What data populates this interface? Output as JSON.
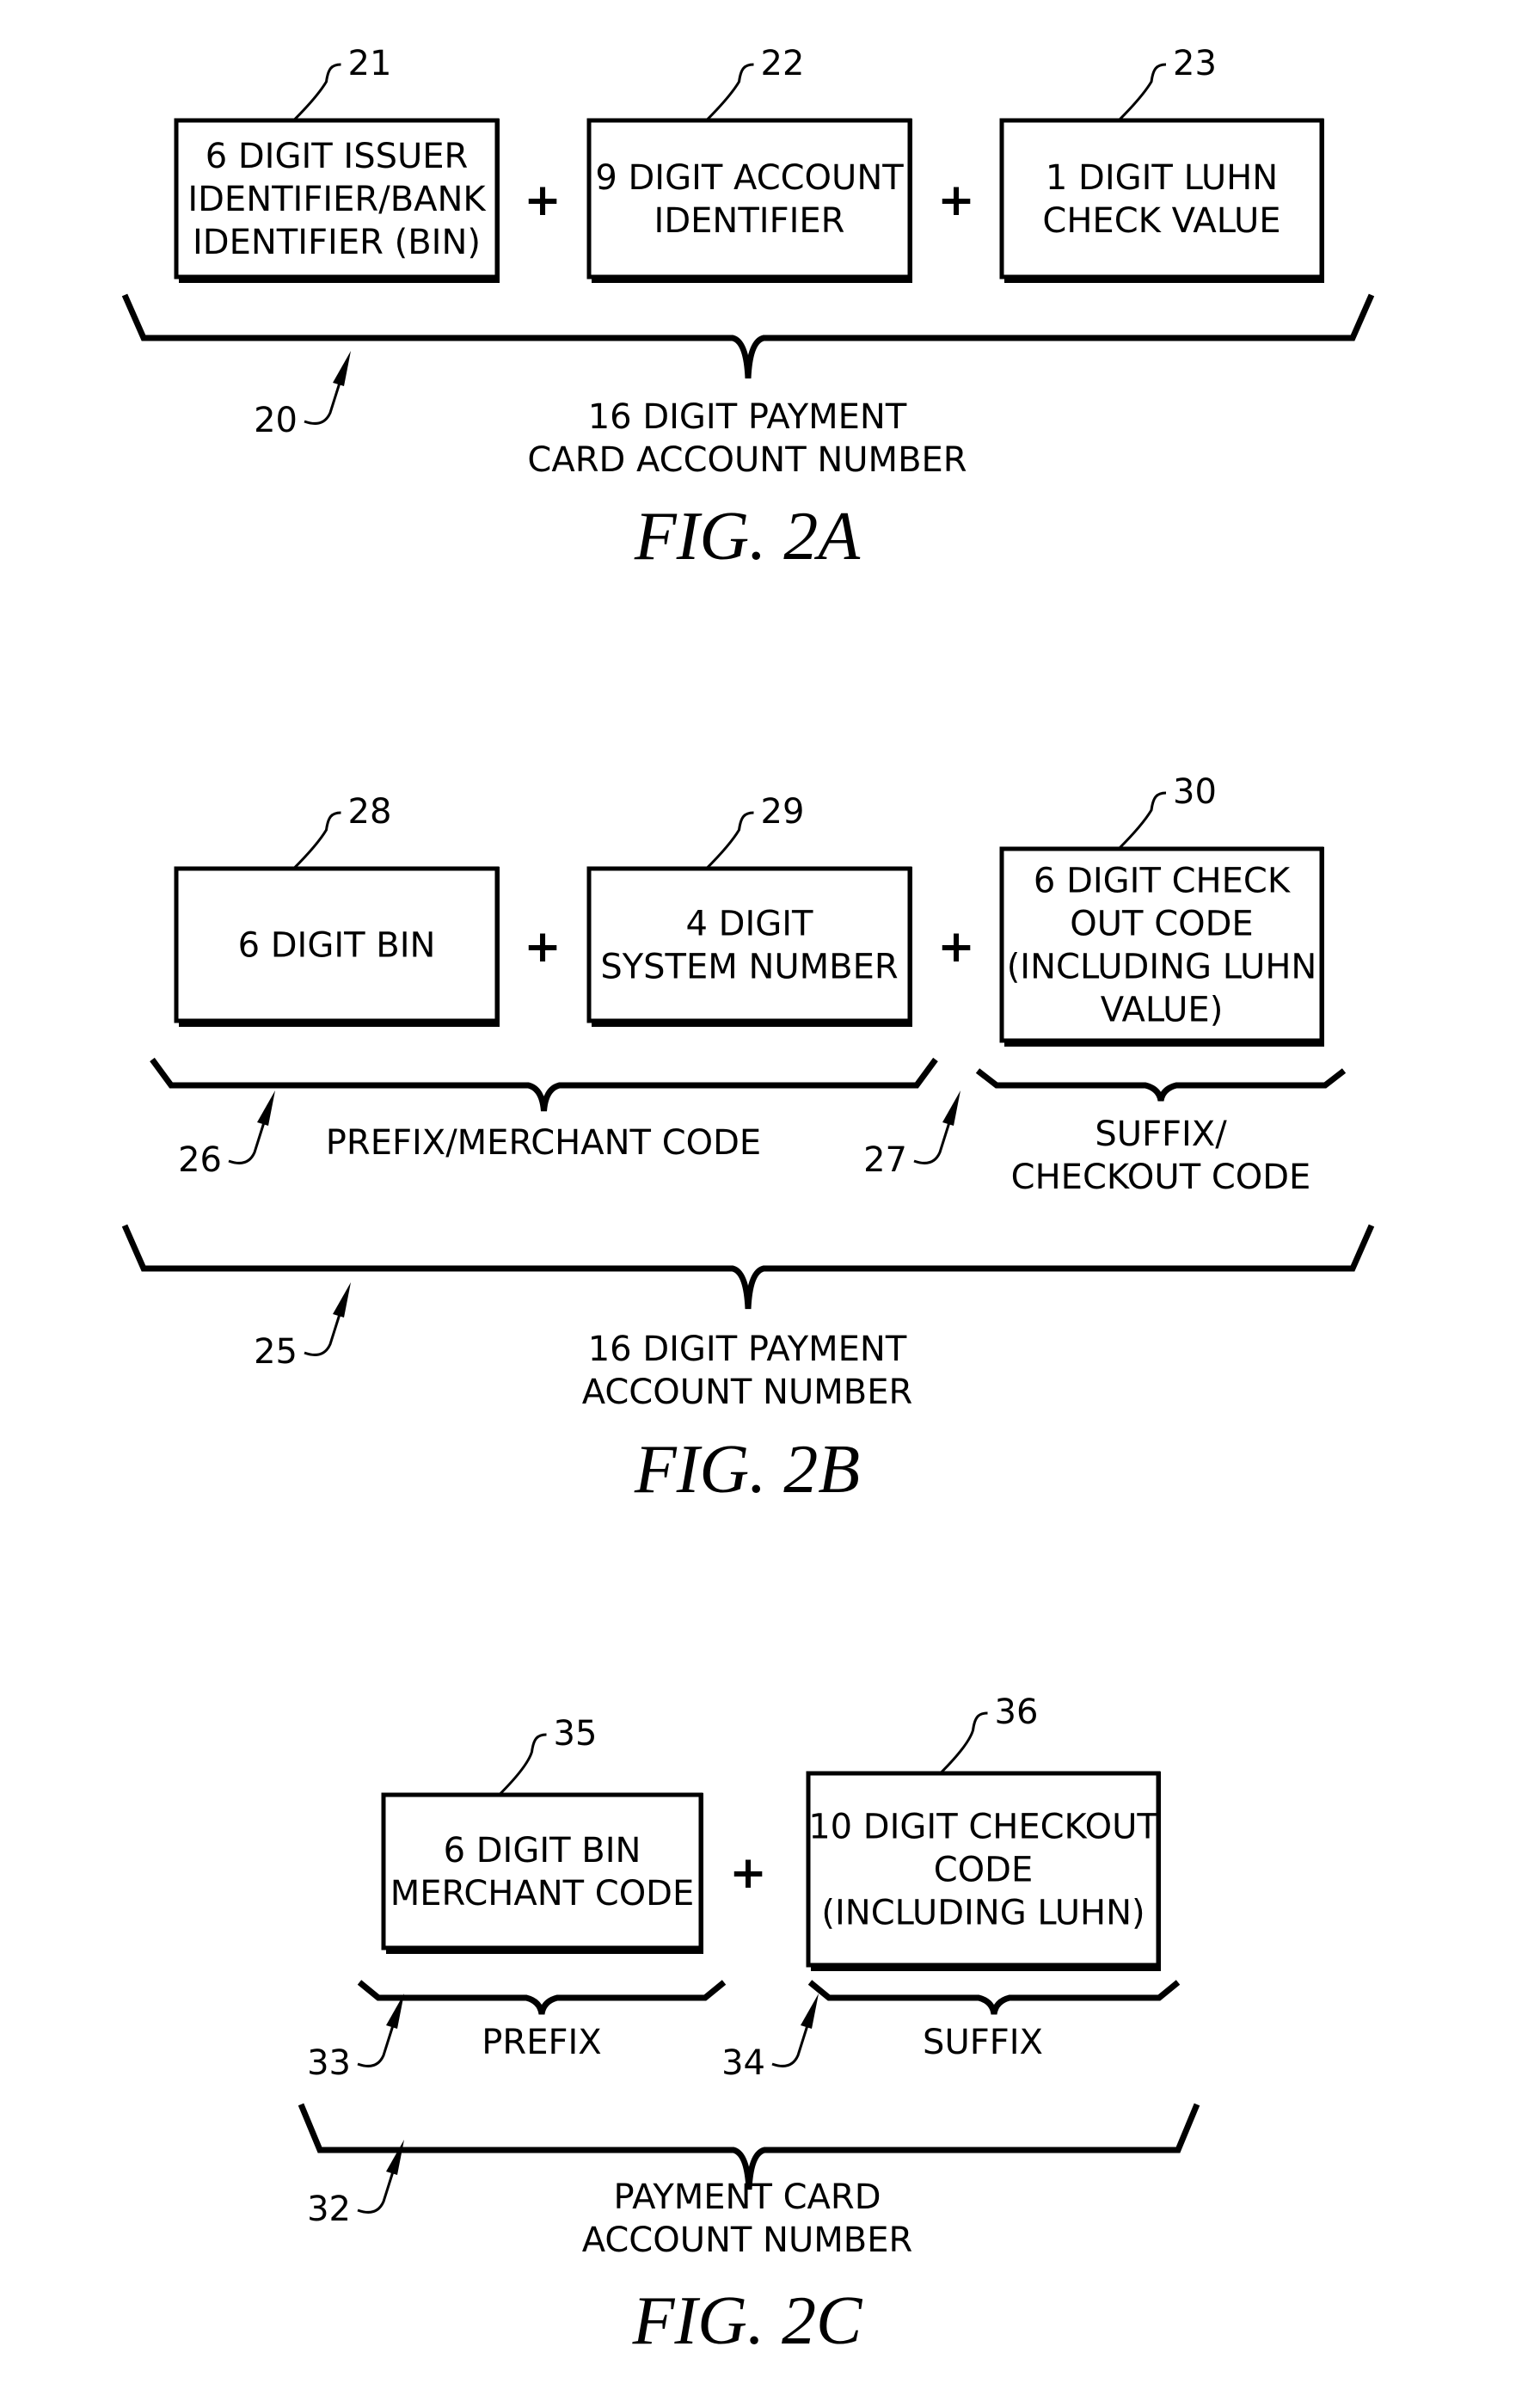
{
  "figures": [
    {
      "id": "fig-2a",
      "caption": "FIG. 2A",
      "boxes": [
        {
          "ref": "21",
          "lines": [
            "6 DIGIT ISSUER",
            "IDENTIFIER/BANK",
            "IDENTIFIER (BIN)"
          ]
        },
        {
          "ref": "22",
          "lines": [
            "9 DIGIT ACCOUNT",
            "IDENTIFIER"
          ]
        },
        {
          "ref": "23",
          "lines": [
            "1 DIGIT LUHN",
            "CHECK VALUE"
          ]
        }
      ],
      "operator": "+",
      "total": {
        "ref": "20",
        "lines": [
          "16 DIGIT PAYMENT",
          "CARD ACCOUNT NUMBER"
        ]
      }
    },
    {
      "id": "fig-2b",
      "caption": "FIG. 2B",
      "boxes": [
        {
          "ref": "28",
          "lines": [
            "6 DIGIT BIN"
          ]
        },
        {
          "ref": "29",
          "lines": [
            "4 DIGIT",
            "SYSTEM NUMBER"
          ]
        },
        {
          "ref": "30",
          "lines": [
            "6 DIGIT CHECK",
            "OUT CODE",
            "(INCLUDING LUHN",
            "VALUE)"
          ]
        }
      ],
      "operator": "+",
      "groups": [
        {
          "ref": "26",
          "lines": [
            "PREFIX/MERCHANT CODE"
          ]
        },
        {
          "ref": "27",
          "lines": [
            "SUFFIX/",
            "CHECKOUT CODE"
          ]
        }
      ],
      "total": {
        "ref": "25",
        "lines": [
          "16 DIGIT PAYMENT",
          "ACCOUNT NUMBER"
        ]
      }
    },
    {
      "id": "fig-2c",
      "caption": "FIG. 2C",
      "boxes": [
        {
          "ref": "35",
          "lines": [
            "6 DIGIT BIN",
            "MERCHANT CODE"
          ]
        },
        {
          "ref": "36",
          "lines": [
            "10 DIGIT CHECKOUT",
            "CODE",
            "(INCLUDING LUHN)"
          ]
        }
      ],
      "operator": "+",
      "groups": [
        {
          "ref": "33",
          "lines": [
            "PREFIX"
          ]
        },
        {
          "ref": "34",
          "lines": [
            "SUFFIX"
          ]
        }
      ],
      "total": {
        "ref": "32",
        "lines": [
          "PAYMENT CARD",
          "ACCOUNT NUMBER"
        ]
      }
    }
  ]
}
